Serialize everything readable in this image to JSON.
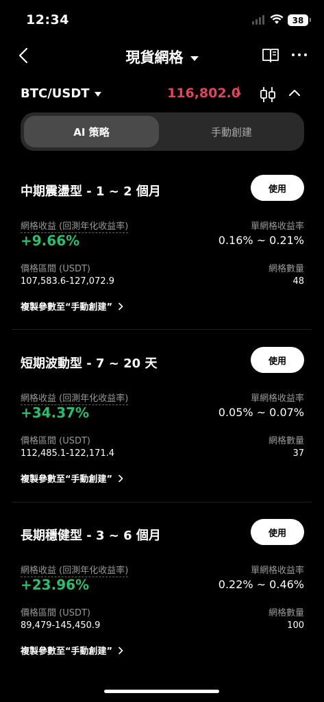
{
  "status": {
    "time": "12:34",
    "battery": "38"
  },
  "nav": {
    "title": "現貨網格"
  },
  "pair": {
    "symbol": "BTC/USDT",
    "price": "116,802.0",
    "price_arrow": "↓",
    "price_color": "#e0455a"
  },
  "tabs": {
    "active": "AI 策略",
    "inactive": "手動創建"
  },
  "labels": {
    "yield": "網格收益 (回測年化收益率)",
    "per_grid": "單網格收益率",
    "range": "價格區間 (USDT)",
    "count": "網格數量",
    "copy": "複製參數至“手動創建”",
    "use": "使用"
  },
  "cards": [
    {
      "title": "中期震盪型 - 1 ~ 2 個月",
      "yield": "+9.66%",
      "per_grid": "0.16% ~ 0.21%",
      "range": "107,583.6-127,072.9",
      "count": "48"
    },
    {
      "title": "短期波動型 - 7 ~ 20 天",
      "yield": "+34.37%",
      "per_grid": "0.05% ~ 0.07%",
      "range": "112,485.1-122,171.4",
      "count": "37"
    },
    {
      "title": "長期穩健型 - 3 ~ 6 個月",
      "yield": "+23.96%",
      "per_grid": "0.22% ~ 0.46%",
      "range": "89,479-145,450.9",
      "count": "100"
    }
  ],
  "colors": {
    "positive": "#2ebd6b",
    "negative": "#e0455a",
    "background": "#000000"
  }
}
